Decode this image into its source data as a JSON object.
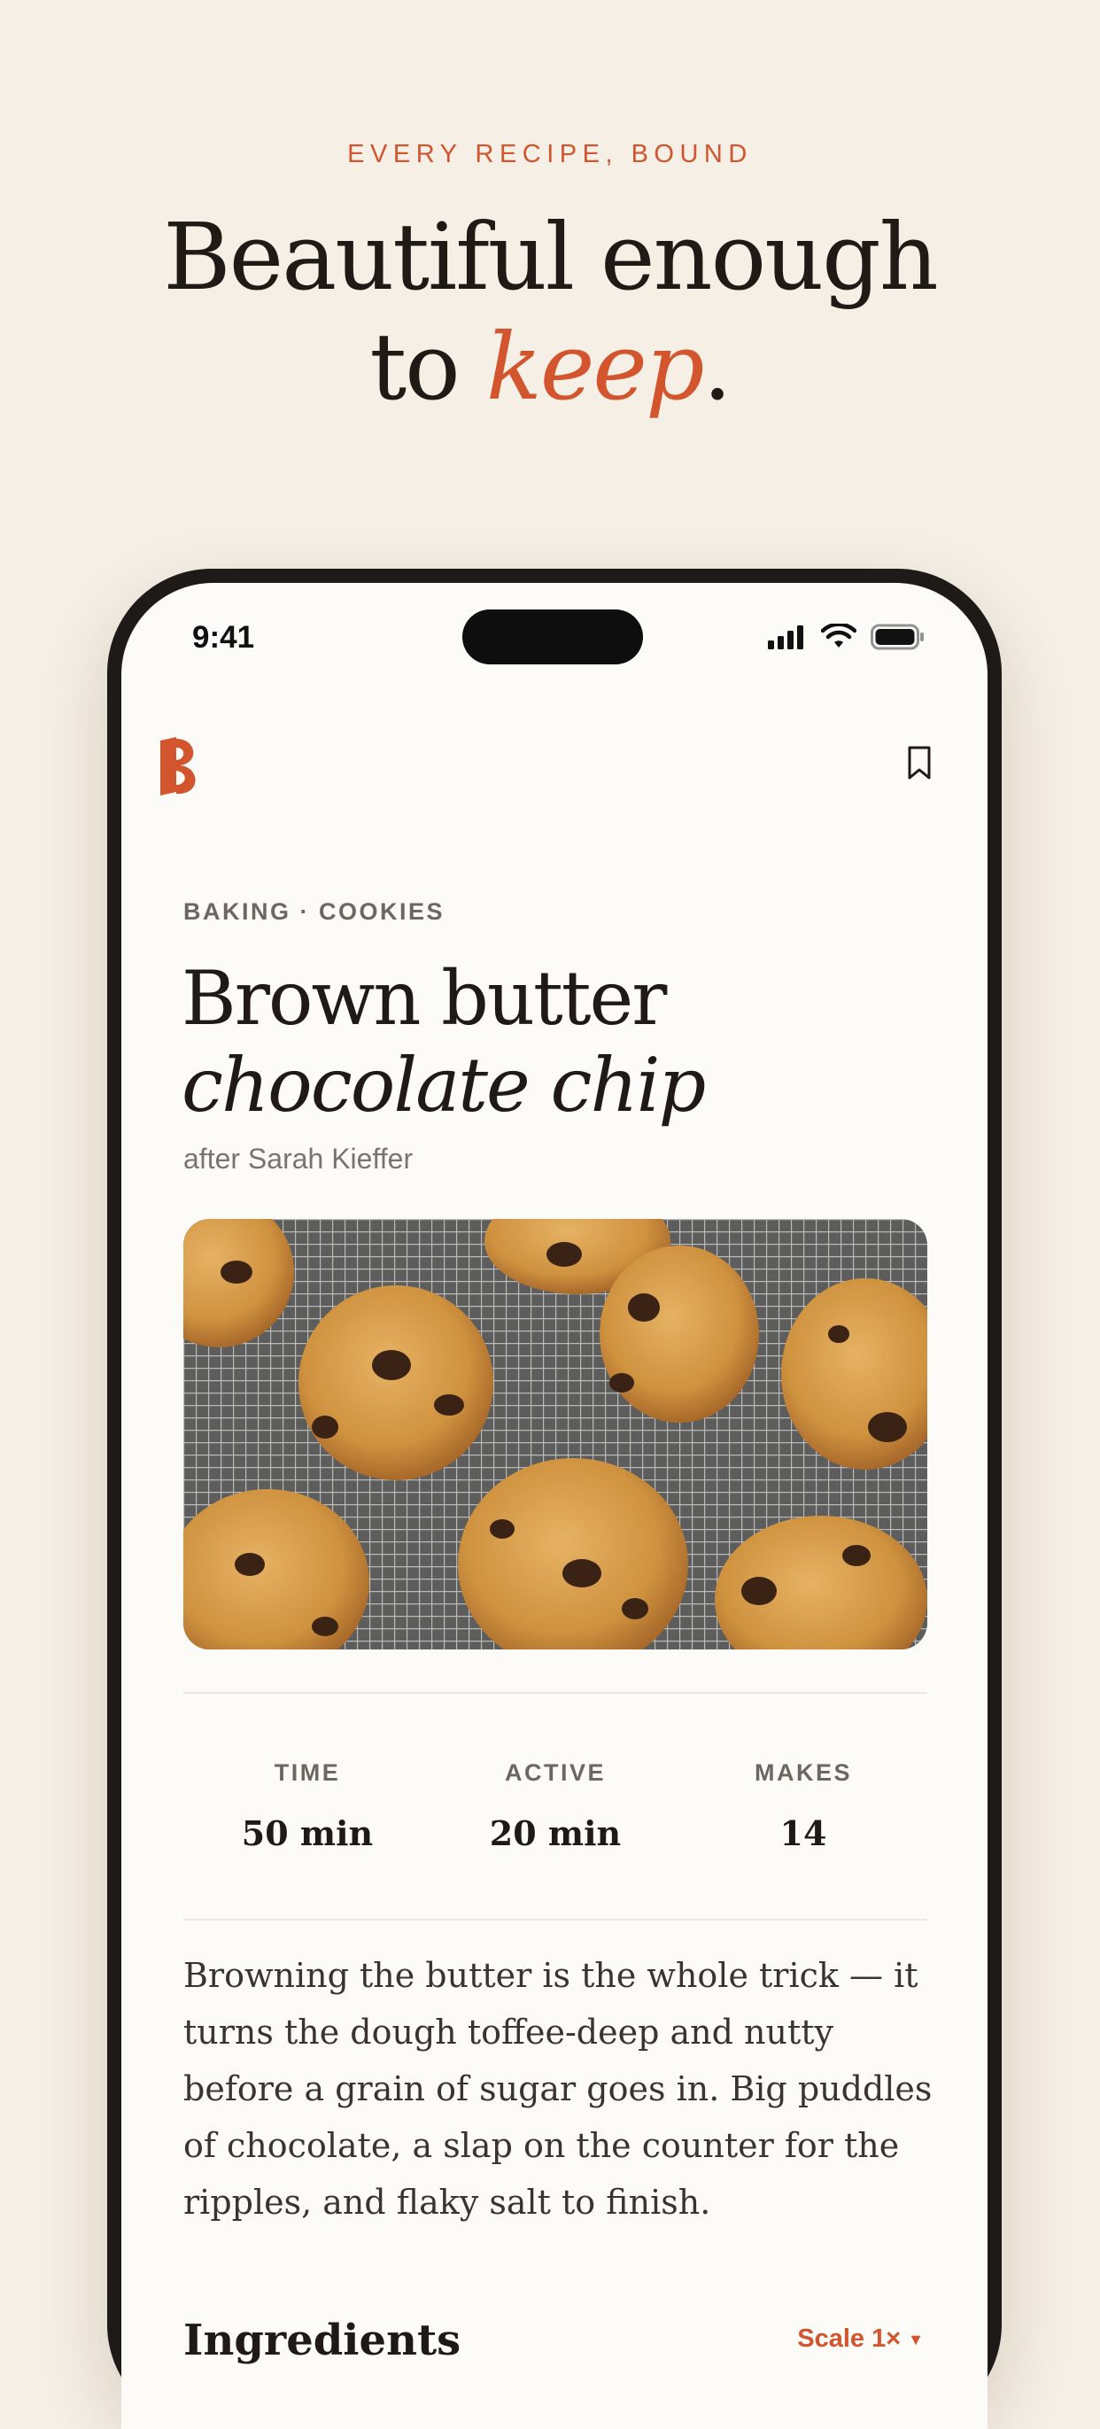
{
  "marketing": {
    "eyebrow": "EVERY RECIPE, BOUND",
    "headline_line1": "Beautiful enough",
    "headline_to": "to ",
    "headline_accent": "keep",
    "headline_period": "."
  },
  "status_bar": {
    "time": "9:41",
    "icons": [
      "signal-icon",
      "wifi-icon",
      "battery-icon"
    ]
  },
  "app": {
    "logo_icon": "brand-b-logo",
    "bookmark_icon": "bookmark-icon"
  },
  "recipe": {
    "category": "BAKING · COOKIES",
    "title_line1": "Brown butter",
    "title_line2": "chocolate chip",
    "byline": "after Sarah Kieffer",
    "stats": [
      {
        "label": "TIME",
        "value": "50 min"
      },
      {
        "label": "ACTIVE",
        "value": "20 min"
      },
      {
        "label": "MAKES",
        "value": "14"
      }
    ],
    "description": "Browning the butter is the whole trick — it turns the dough toffee-deep and nutty before a grain of sugar goes in. Big puddles of chocolate, a slap on the counter for the ripples, and flaky salt to finish.",
    "ingredients_heading": "Ingredients",
    "scale_label": "Scale 1×"
  },
  "colors": {
    "accent": "#d2552d",
    "ink": "#1f1a16",
    "background": "#f5efe6",
    "card": "#fcfbf8"
  }
}
